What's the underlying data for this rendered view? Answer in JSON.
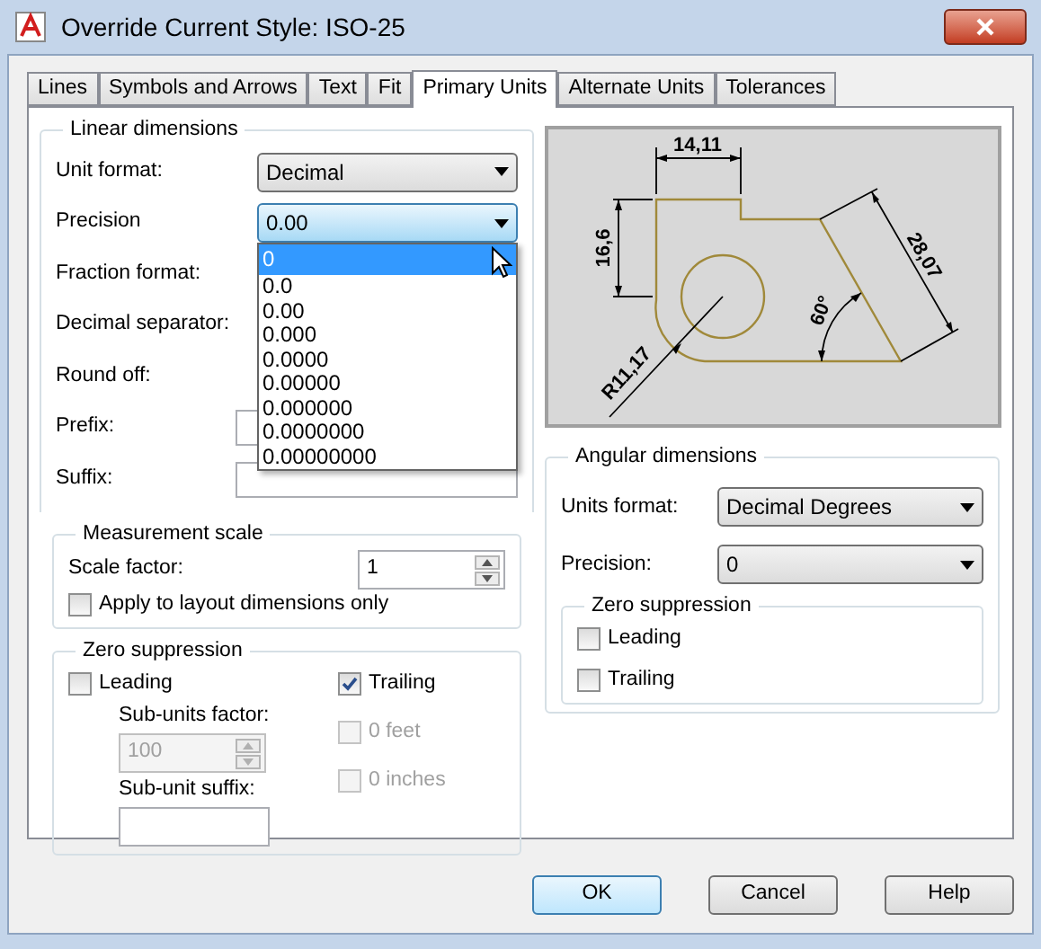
{
  "window": {
    "title": "Override Current Style: ISO-25"
  },
  "tabs": [
    {
      "label": "Lines",
      "selected": false
    },
    {
      "label": "Symbols and Arrows",
      "selected": false
    },
    {
      "label": "Text",
      "selected": false
    },
    {
      "label": "Fit",
      "selected": false
    },
    {
      "label": "Primary Units",
      "selected": true
    },
    {
      "label": "Alternate Units",
      "selected": false
    },
    {
      "label": "Tolerances",
      "selected": false
    }
  ],
  "linear": {
    "title": "Linear dimensions",
    "rows": [
      {
        "label": "Unit format:",
        "kind": "combo",
        "value": "Decimal"
      },
      {
        "label": "Precision",
        "kind": "combo",
        "value": "0.00",
        "open": true
      },
      {
        "label": "Fraction format:",
        "kind": "covered"
      },
      {
        "label": "Decimal separator:",
        "kind": "covered"
      },
      {
        "label": "Round off:",
        "kind": "covered"
      },
      {
        "label": "Prefix:",
        "kind": "field"
      },
      {
        "label": "Suffix:",
        "kind": "field"
      }
    ]
  },
  "precision_list": {
    "items": [
      {
        "label": "0",
        "selected": true
      },
      {
        "label": "0.0",
        "selected": false
      },
      {
        "label": "0.00",
        "selected": false
      },
      {
        "label": "0.000",
        "selected": false
      },
      {
        "label": "0.0000",
        "selected": false
      },
      {
        "label": "0.00000",
        "selected": false
      },
      {
        "label": "0.000000",
        "selected": false
      },
      {
        "label": "0.0000000",
        "selected": false
      },
      {
        "label": "0.00000000",
        "selected": false
      }
    ]
  },
  "measurement": {
    "title": "Measurement scale",
    "scale_label": "Scale factor:",
    "scale_value": "1",
    "apply": {
      "label": "Apply to layout dimensions only",
      "checked": false,
      "disabled": false
    }
  },
  "zero_linear": {
    "title": "Zero suppression",
    "leading": {
      "label": "Leading",
      "checked": false,
      "disabled": false
    },
    "trailing": {
      "label": "Trailing",
      "checked": true,
      "disabled": false
    },
    "sub_units_factor": {
      "label": "Sub-units factor:",
      "value": "100",
      "disabled": true
    },
    "sub_unit_suffix": {
      "label": "Sub-unit suffix:"
    },
    "feet": {
      "label": "0 feet",
      "checked": false,
      "disabled": true
    },
    "inches": {
      "label": "0 inches",
      "checked": false,
      "disabled": true
    }
  },
  "preview": {
    "labels": [
      "14,11",
      "16,6",
      "28,07",
      "60°",
      "R11,17"
    ]
  },
  "angular": {
    "title": "Angular dimensions",
    "rows": [
      {
        "label": "Units format:",
        "value": "Decimal Degrees"
      },
      {
        "label": "Precision:",
        "value": "0"
      }
    ],
    "zero": {
      "title": "Zero suppression",
      "items": [
        {
          "label": "Leading",
          "checked": false,
          "disabled": false
        },
        {
          "label": "Trailing",
          "checked": false,
          "disabled": false
        }
      ]
    }
  },
  "buttons": [
    {
      "label": "OK",
      "default": true
    },
    {
      "label": "Cancel",
      "default": false
    },
    {
      "label": "Help",
      "default": false
    }
  ]
}
